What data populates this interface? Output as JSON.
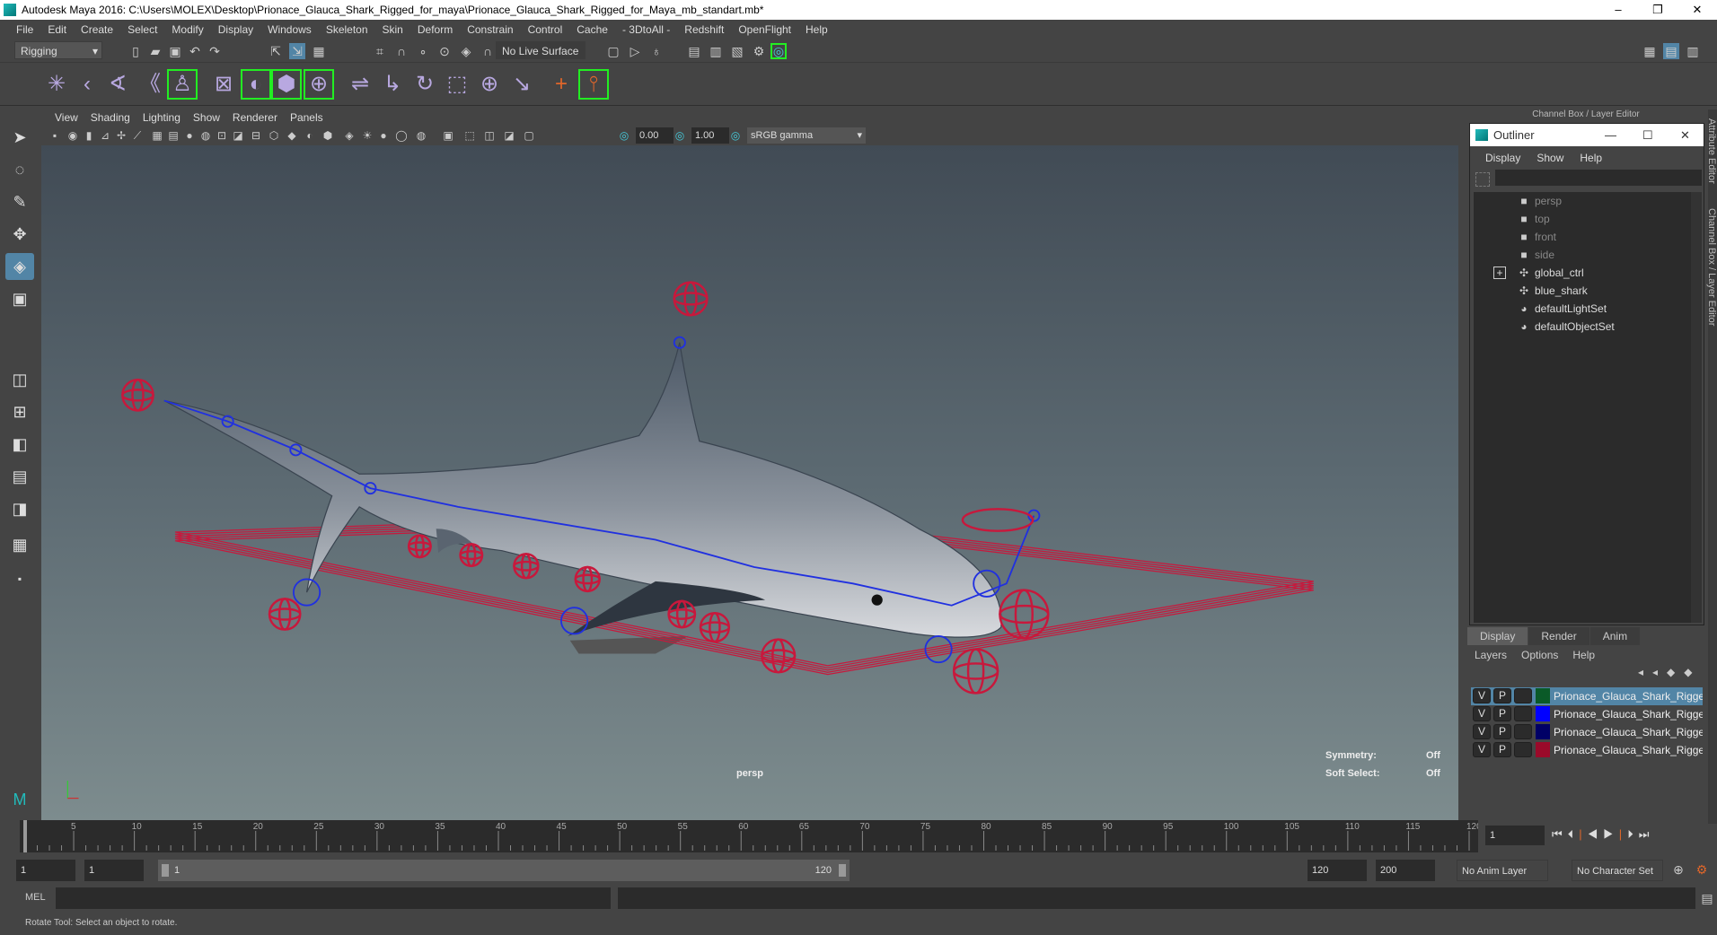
{
  "window": {
    "title": "Autodesk Maya 2016: C:\\Users\\MOLEX\\Desktop\\Prionace_Glauca_Shark_Rigged_for_maya\\Prionace_Glauca_Shark_Rigged_for_Maya_mb_standart.mb*",
    "minimize": "–",
    "restore": "❐",
    "close": "✕"
  },
  "menubar": [
    "File",
    "Edit",
    "Create",
    "Select",
    "Modify",
    "Display",
    "Windows",
    "Skeleton",
    "Skin",
    "Deform",
    "Constrain",
    "Control",
    "Cache",
    "- 3DtoAll -",
    "Redshift",
    "OpenFlight",
    "Help"
  ],
  "statusline": {
    "mode": "Rigging",
    "live_surface": "No Live Surface"
  },
  "viewport": {
    "menu": [
      "View",
      "Shading",
      "Lighting",
      "Show",
      "Renderer",
      "Panels"
    ],
    "exposure": "0.00",
    "gamma": "1.00",
    "color_space": "sRGB gamma",
    "camera": "persp",
    "hud": {
      "symmetry_label": "Symmetry:",
      "symmetry_value": "Off",
      "soft_select_label": "Soft Select:",
      "soft_select_value": "Off"
    },
    "colors": {
      "controls": "#c8183c",
      "joints": "#2030e0"
    }
  },
  "channel_box": {
    "title": "Channel Box / Layer Editor"
  },
  "side_tabs": [
    "Attribute Editor",
    "Channel Box / Layer Editor"
  ],
  "outliner": {
    "title": "Outliner",
    "menu": [
      "Display",
      "Show",
      "Help"
    ],
    "items": [
      {
        "name": "persp",
        "icon": "camera-icon",
        "dim": true
      },
      {
        "name": "top",
        "icon": "camera-icon",
        "dim": true
      },
      {
        "name": "front",
        "icon": "camera-icon",
        "dim": true
      },
      {
        "name": "side",
        "icon": "camera-icon",
        "dim": true
      },
      {
        "name": "global_ctrl",
        "icon": "transform-icon",
        "expandable": true
      },
      {
        "name": "blue_shark",
        "icon": "transform-icon"
      },
      {
        "name": "defaultLightSet",
        "icon": "set-icon"
      },
      {
        "name": "defaultObjectSet",
        "icon": "set-icon"
      }
    ]
  },
  "layer_editor": {
    "tabs": [
      "Display",
      "Render",
      "Anim"
    ],
    "active_tab": "Display",
    "menu": [
      "Layers",
      "Options",
      "Help"
    ],
    "layers": [
      {
        "v": "V",
        "p": "P",
        "name": "Prionace_Glauca_Shark_Rigged",
        "color": "#0a5a28",
        "selected": true
      },
      {
        "v": "V",
        "p": "P",
        "name": "Prionace_Glauca_Shark_Rigged_",
        "color": "#0000ff"
      },
      {
        "v": "V",
        "p": "P",
        "name": "Prionace_Glauca_Shark_Rigged_",
        "color": "#000066"
      },
      {
        "v": "V",
        "p": "P",
        "name": "Prionace_Glauca_Shark_Rigged_",
        "color": "#9a0a2a"
      }
    ]
  },
  "timeline": {
    "start": 1,
    "end": 120,
    "label_step": 5,
    "current_frame": "1"
  },
  "range": {
    "start": "1",
    "playback_start": "1",
    "slider_start": "1",
    "slider_end": "120",
    "playback_end": "120",
    "end": "200",
    "anim_layer": "No Anim Layer",
    "character_set": "No Character Set"
  },
  "command_line": {
    "label": "MEL"
  },
  "help_line": "Rotate Tool: Select an object to rotate."
}
